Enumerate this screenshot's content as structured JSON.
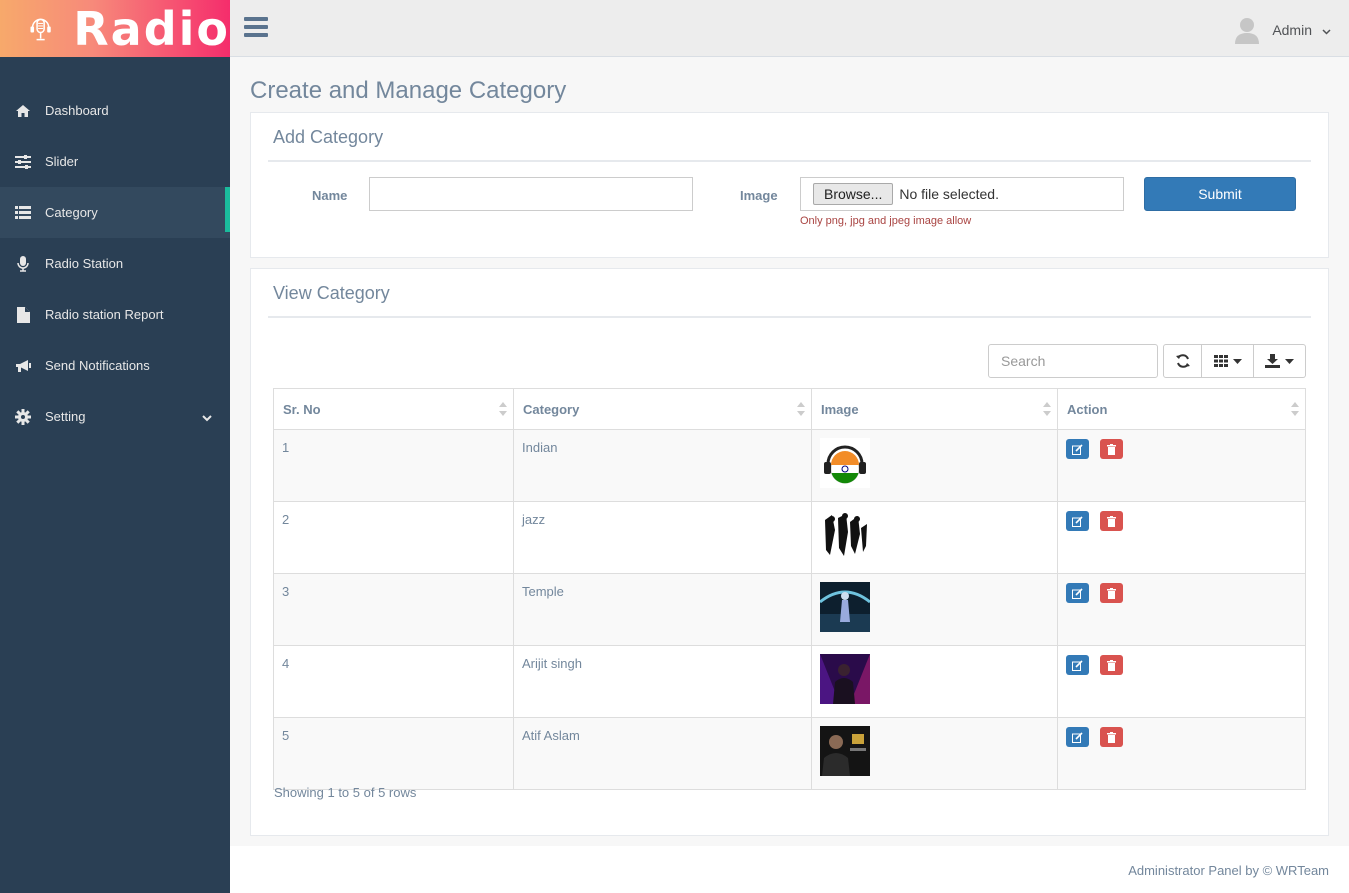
{
  "brand": {
    "title": "Radio"
  },
  "sidebar": {
    "items": [
      {
        "label": "Dashboard",
        "icon": "home-icon"
      },
      {
        "label": "Slider",
        "icon": "sliders-icon"
      },
      {
        "label": "Category",
        "icon": "list-icon",
        "active": true
      },
      {
        "label": "Radio Station",
        "icon": "microphone-icon"
      },
      {
        "label": "Radio station Report",
        "icon": "file-icon"
      },
      {
        "label": "Send Notifications",
        "icon": "bullhorn-icon"
      },
      {
        "label": "Setting",
        "icon": "gear-icon"
      }
    ]
  },
  "header": {
    "user": "Admin"
  },
  "page": {
    "title": "Create and Manage Category"
  },
  "add_form": {
    "heading": "Add Category",
    "name_label": "Name",
    "image_label": "Image",
    "browse_label": "Browse...",
    "no_file": "No file selected.",
    "hint": "Only png, jpg and jpeg image allow",
    "submit": "Submit"
  },
  "view": {
    "heading": "View Category",
    "search_placeholder": "Search",
    "columns": [
      "Sr. No",
      "Category",
      "Image",
      "Action"
    ],
    "rows": [
      {
        "sr": "1",
        "category": "Indian"
      },
      {
        "sr": "2",
        "category": "jazz"
      },
      {
        "sr": "3",
        "category": "Temple"
      },
      {
        "sr": "4",
        "category": "Arijit singh"
      },
      {
        "sr": "5",
        "category": "Atif Aslam"
      }
    ],
    "showing": "Showing 1 to 5 of 5 rows"
  },
  "footer": {
    "text": "Administrator Panel by © WRTeam"
  },
  "colors": {
    "sidebar": "#2a3f54",
    "accent": "#1abb9c",
    "primary": "#337ab7",
    "danger": "#d9534f"
  }
}
